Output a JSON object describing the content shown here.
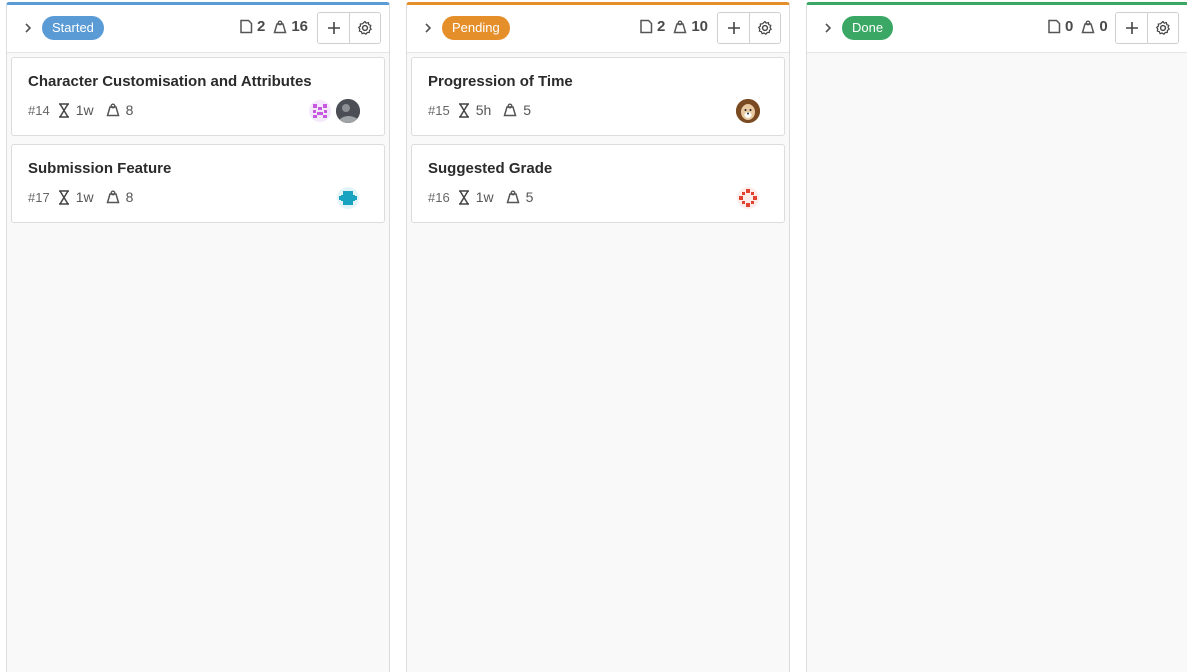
{
  "columns": [
    {
      "status": "Started",
      "status_color": "#5b9bd5",
      "story_count": "2",
      "points_total": "16",
      "cards": [
        {
          "number": "#14",
          "title": "Character Customisation and Attributes",
          "estimate": "1w",
          "points": "8",
          "avatars": [
            "identicon-purple",
            "photo-avatar"
          ]
        },
        {
          "number": "#17",
          "title": "Submission Feature",
          "estimate": "1w",
          "points": "8",
          "avatars": [
            "identicon-teal"
          ]
        }
      ]
    },
    {
      "status": "Pending",
      "status_color": "#e58f2a",
      "story_count": "2",
      "points_total": "10",
      "cards": [
        {
          "number": "#15",
          "title": "Progression of Time",
          "estimate": "5h",
          "points": "5",
          "avatars": [
            "dog-photo-avatar"
          ]
        },
        {
          "number": "#16",
          "title": "Suggested Grade",
          "estimate": "1w",
          "points": "5",
          "avatars": [
            "identicon-red"
          ]
        }
      ]
    },
    {
      "status": "Done",
      "status_color": "#3aa864",
      "story_count": "0",
      "points_total": "0",
      "cards": []
    }
  ]
}
